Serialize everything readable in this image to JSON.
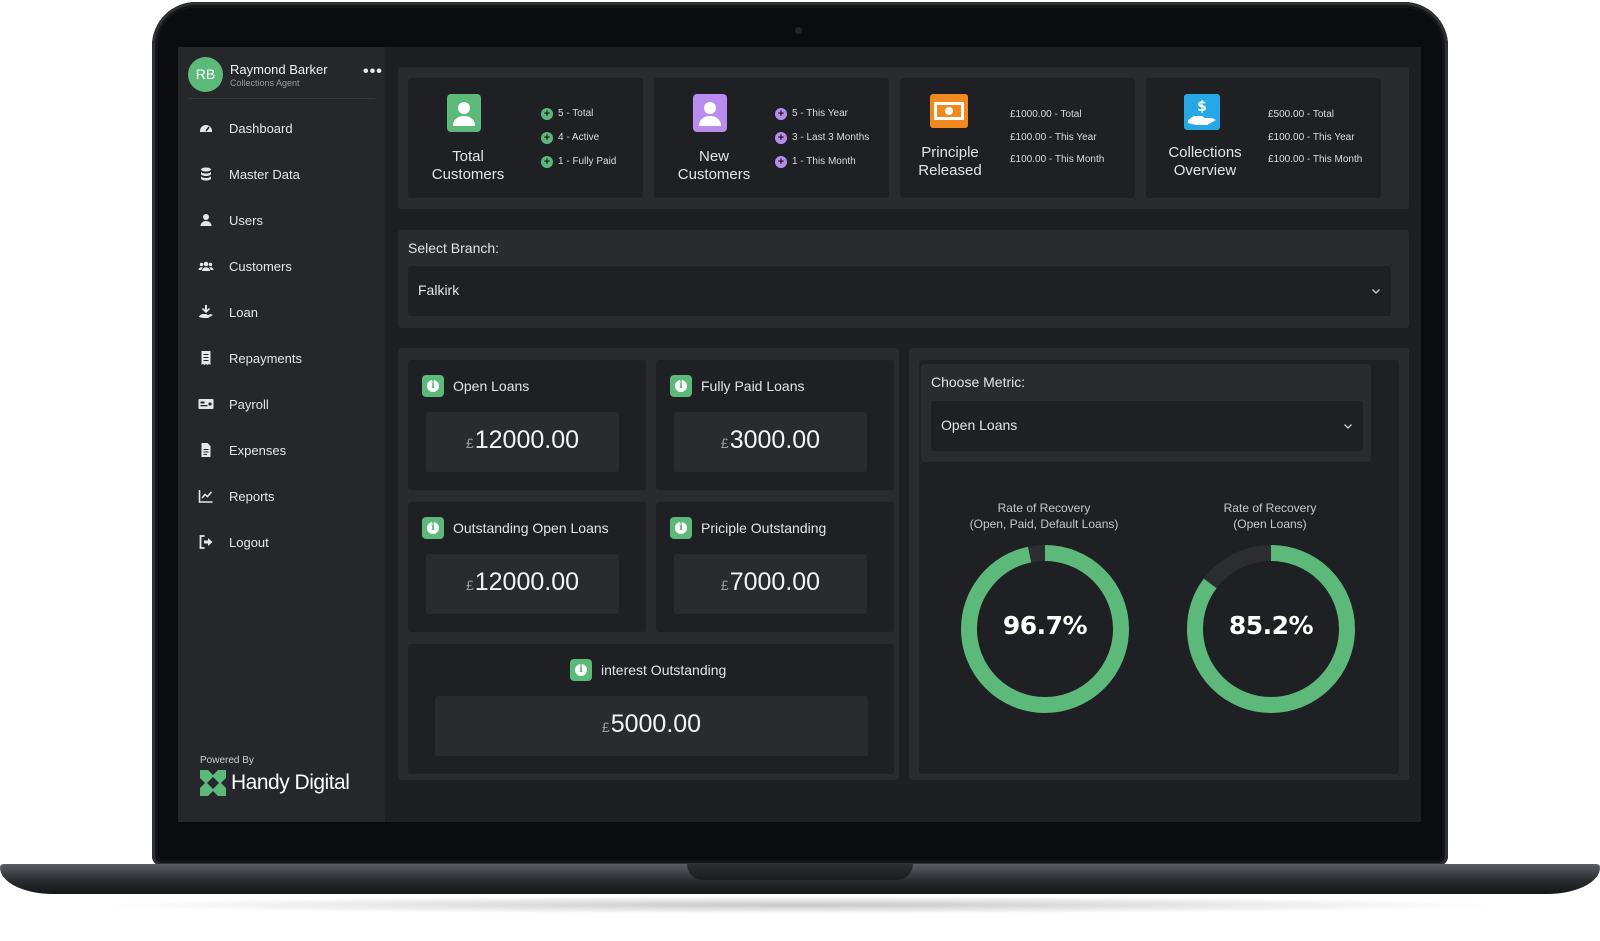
{
  "user": {
    "initials": "RB",
    "name": "Raymond Barker",
    "role": "Collections Agent",
    "menu": "•••"
  },
  "nav": [
    {
      "label": "Dashboard",
      "icon": "dashboard-icon"
    },
    {
      "label": "Master Data",
      "icon": "database-icon"
    },
    {
      "label": "Users",
      "icon": "user-icon"
    },
    {
      "label": "Customers",
      "icon": "users-icon"
    },
    {
      "label": "Loan",
      "icon": "hand-coin-icon"
    },
    {
      "label": "Repayments",
      "icon": "receipt-icon"
    },
    {
      "label": "Payroll",
      "icon": "money-card-icon"
    },
    {
      "label": "Expenses",
      "icon": "file-icon"
    },
    {
      "label": "Reports",
      "icon": "chart-line-icon"
    },
    {
      "label": "Logout",
      "icon": "logout-icon"
    }
  ],
  "footer": {
    "powered_by": "Powered By",
    "brand": "Handy Digital"
  },
  "stats": {
    "total_customers": {
      "title_line1": "Total",
      "title_line2": "Customers",
      "rows": [
        "5 - Total",
        "4 - Active",
        "1 - Fully Paid"
      ],
      "color": "#5cb97a"
    },
    "new_customers": {
      "title_line1": "New",
      "title_line2": "Customers",
      "rows": [
        "5 - This Year",
        "3 - Last 3 Months",
        "1 - This Month"
      ],
      "color": "#b98cf0"
    },
    "principle_released": {
      "title_line1": "Principle",
      "title_line2": "Released",
      "rows": [
        "£1000.00 - Total",
        "£100.00 - This Year",
        "£100.00 - This Month"
      ],
      "color": "#f08a1e"
    },
    "collections_overview": {
      "title_line1": "Collections",
      "title_line2": "Overview",
      "rows": [
        "£500.00 - Total",
        "£100.00 - This Year",
        "£100.00 - This Month"
      ],
      "color": "#26a7e6"
    }
  },
  "branch": {
    "label": "Select Branch:",
    "value": "Falkirk"
  },
  "metrics": {
    "open_loans": {
      "title": "Open Loans",
      "currency": "£",
      "value": "12000.00"
    },
    "fully_paid_loans": {
      "title": "Fully Paid Loans",
      "currency": "£",
      "value": "3000.00"
    },
    "outstanding_open_loans": {
      "title": "Outstanding Open Loans",
      "currency": "£",
      "value": "12000.00"
    },
    "priciple_outstanding": {
      "title": "Priciple Outstanding",
      "currency": "£",
      "value": "7000.00"
    },
    "interest_outstanding": {
      "title": "interest Outstanding",
      "currency": "£",
      "value": "5000.00"
    }
  },
  "choose_metric": {
    "label": "Choose Metric:",
    "value": "Open Loans"
  },
  "recovery": [
    {
      "title_line1": "Rate of Recovery",
      "title_line2": "(Open, Paid, Default Loans)",
      "label": "96.7%",
      "percent": 96.7
    },
    {
      "title_line1": "Rate of Recovery",
      "title_line2": "(Open Loans)",
      "label": "85.2%",
      "percent": 85.2
    }
  ],
  "colors": {
    "accent": "#5cb97a",
    "track": "#2c2d31"
  }
}
